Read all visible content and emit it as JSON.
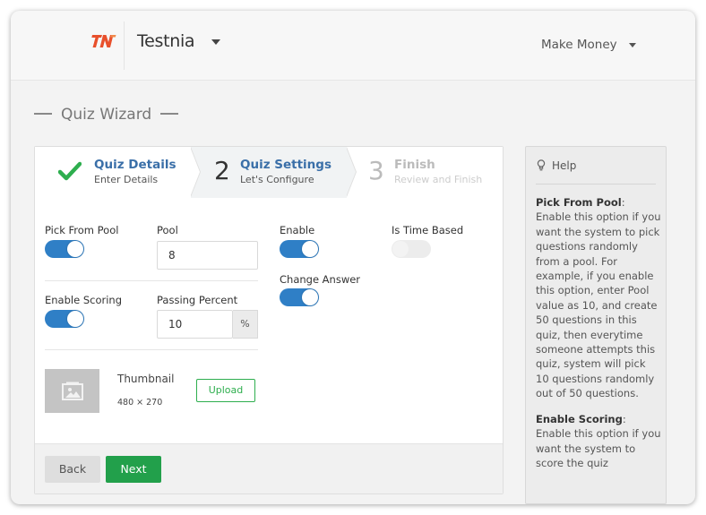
{
  "header": {
    "brand": "Testnia",
    "account_label": "Make Money"
  },
  "page": {
    "title": "Quiz Wizard"
  },
  "steps": [
    {
      "number": "",
      "title": "Quiz Details",
      "subtitle": "Enter Details",
      "status": "done"
    },
    {
      "number": "2",
      "title": "Quiz Settings",
      "subtitle": "Let's Configure",
      "status": "active"
    },
    {
      "number": "3",
      "title": "Finish",
      "subtitle": "Review and Finish",
      "status": "pending"
    }
  ],
  "settings": {
    "pick_from_pool_label": "Pick From Pool",
    "pick_from_pool_on": true,
    "pool_label": "Pool",
    "pool_value": "8",
    "enable_label": "Enable",
    "enable_on": true,
    "is_time_based_label": "Is Time Based",
    "is_time_based_on": false,
    "change_answer_label": "Change Answer",
    "change_answer_on": true,
    "enable_scoring_label": "Enable Scoring",
    "enable_scoring_on": true,
    "passing_percent_label": "Passing Percent",
    "passing_percent_value": "10",
    "percent_suffix": "%"
  },
  "thumbnail": {
    "label": "Thumbnail",
    "size": "480 × 270",
    "upload_label": "Upload"
  },
  "footer": {
    "back_label": "Back",
    "next_label": "Next"
  },
  "help": {
    "heading": "Help",
    "pick_from_pool_title": "Pick From Pool",
    "pick_from_pool_text": "Enable this option if you want the system to pick questions randomly from a pool. For example, if you enable this option, enter Pool value as 10, and create 50 questions in this quiz, then everytime someone attempts this quiz, system will pick 10 questions randomly out of 50 questions.",
    "enable_scoring_title": "Enable Scoring",
    "enable_scoring_text": "Enable this option if you want the system to score the quiz"
  },
  "colors": {
    "primary_blue": "#2f7fc6",
    "step_title_blue": "#3a6fa8",
    "success_green": "#22a04b",
    "logo_red": "#e8502c"
  }
}
